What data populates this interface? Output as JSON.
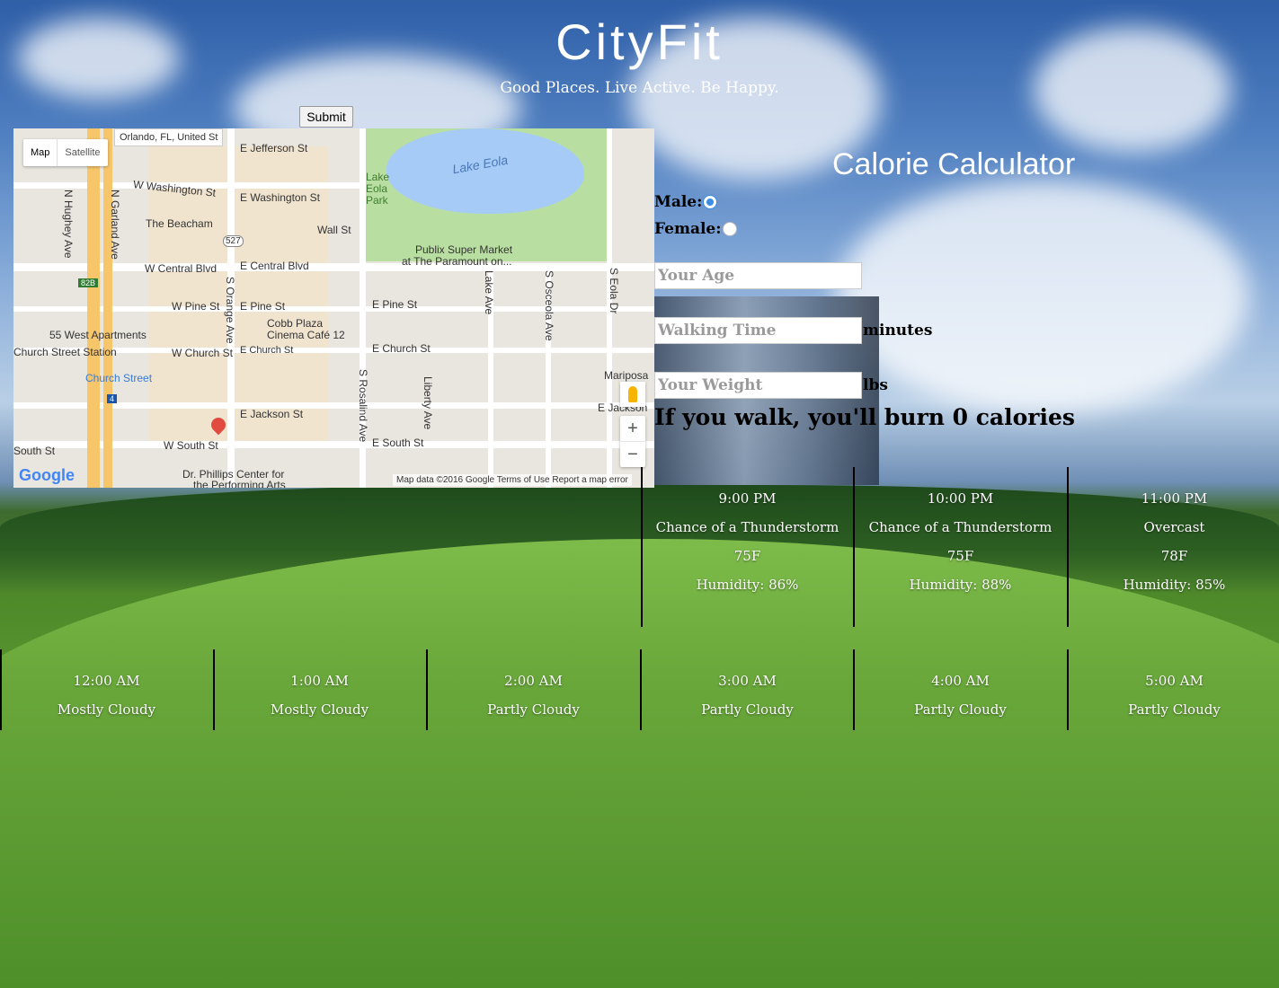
{
  "header": {
    "title": "CityFit",
    "tagline": "Good Places. Live Active. Be Happy."
  },
  "search": {
    "submit_label": "Submit"
  },
  "map": {
    "type_buttons": [
      "Map",
      "Satellite"
    ],
    "location": "Orlando, FL, United St",
    "streets": {
      "jefferson": "E Jefferson St",
      "w_washington": "W Washington St",
      "e_washington": "E Washington St",
      "beacham": "The Beacham",
      "wall": "Wall St",
      "w_central": "W Central Blvd",
      "e_central": "E Central Blvd",
      "publix": "Publix Super Market",
      "publix2": "at The Paramount on...",
      "w_pine": "W Pine St",
      "e_pine_1": "E Pine St",
      "e_pine_2": "E Pine St",
      "cobb1": "Cobb Plaza",
      "cobb2": "Cinema Café 12",
      "west55": "55 West Apartments",
      "church_station": "Church Street Station",
      "w_church": "W Church St",
      "e_church_1": "E Church St",
      "e_church_2": "E Church St",
      "church_street": "Church Street",
      "mariposa": "Mariposa",
      "e_jackson_1": "E Jackson St",
      "e_jackson_2": "E Jackson",
      "w_south": "W South St",
      "e_south": "E South St",
      "south_st": "South St",
      "dr_phillips1": "Dr. Phillips Center for",
      "dr_phillips2": "the Performing Arts",
      "n_hughey": "N Hughey Ave",
      "n_garland": "N Garland Ave",
      "s_orange": "S Orange Ave",
      "s_rosalind": "S Rosalind Ave",
      "liberty": "Liberty Ave",
      "lake_ave": "Lake Ave",
      "s_osceola": "S Osceola Ave",
      "s_eola": "S Eola Dr",
      "route_527": "527",
      "route_82b": "82B",
      "route_4": "4",
      "lake_eola": "Lake Eola",
      "lake_eola_park": "Lake Eola Park"
    },
    "zoom_in": "+",
    "zoom_out": "−",
    "google": "Google",
    "attribution": "Map data ©2016 Google    Terms of Use    Report a map error"
  },
  "calculator": {
    "title": "Calorie Calculator",
    "male_label": "Male:",
    "female_label": "Female:",
    "gender_selected": "Male",
    "age_placeholder": "Your Age",
    "walking_placeholder": "Walking Time",
    "walking_unit": "minutes",
    "weight_placeholder": "Your Weight",
    "weight_unit": "lbs",
    "result": "If you walk, you'll burn 0 calories"
  },
  "weather_top": [
    {
      "time": "9:00 PM",
      "condition": "Chance of a Thunderstorm",
      "temp": "75F",
      "humidity": "Humidity: 86%"
    },
    {
      "time": "10:00 PM",
      "condition": "Chance of a Thunderstorm",
      "temp": "75F",
      "humidity": "Humidity: 88%"
    },
    {
      "time": "11:00 PM",
      "condition": "Overcast",
      "temp": "78F",
      "humidity": "Humidity: 85%"
    }
  ],
  "weather_bottom": [
    {
      "time": "12:00 AM",
      "condition": "Mostly Cloudy"
    },
    {
      "time": "1:00 AM",
      "condition": "Mostly Cloudy"
    },
    {
      "time": "2:00 AM",
      "condition": "Partly Cloudy"
    },
    {
      "time": "3:00 AM",
      "condition": "Partly Cloudy"
    },
    {
      "time": "4:00 AM",
      "condition": "Partly Cloudy"
    },
    {
      "time": "5:00 AM",
      "condition": "Partly Cloudy"
    }
  ]
}
